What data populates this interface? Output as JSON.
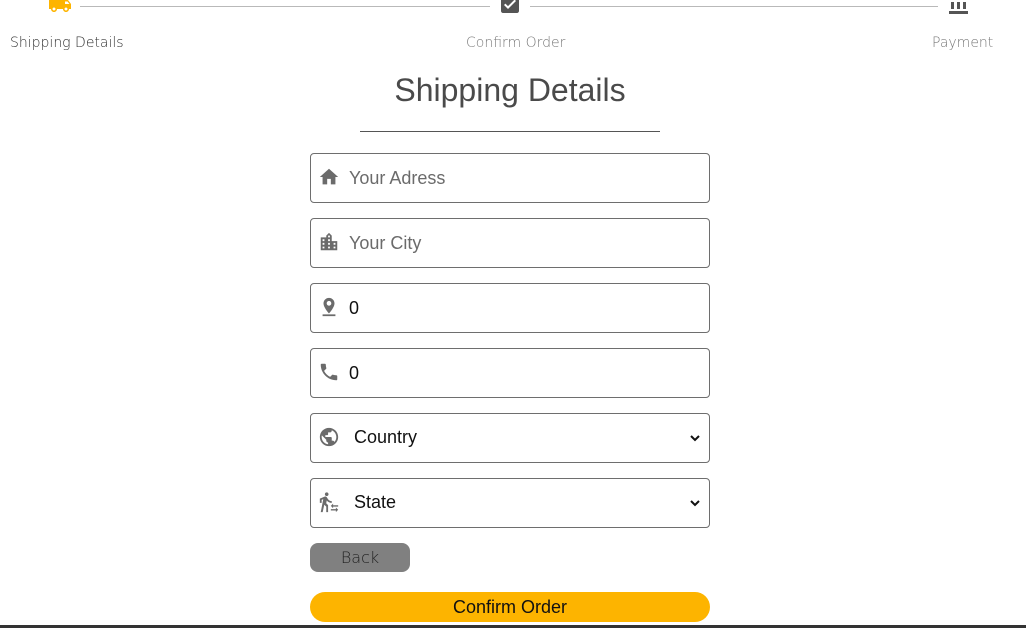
{
  "stepper": {
    "steps": [
      {
        "label": "Shipping Details",
        "icon": "truck-icon",
        "active": true
      },
      {
        "label": "Confirm Order",
        "icon": "checklist-icon",
        "active": false
      },
      {
        "label": "Payment",
        "icon": "bank-icon",
        "active": false
      }
    ]
  },
  "page": {
    "title": "Shipping Details"
  },
  "form": {
    "address": {
      "placeholder": "Your Adress",
      "value": "",
      "icon": "home-icon"
    },
    "city": {
      "placeholder": "Your City",
      "value": "",
      "icon": "city-icon"
    },
    "pincode": {
      "value": "0",
      "icon": "location-pin-icon"
    },
    "phone": {
      "value": "0",
      "icon": "phone-icon"
    },
    "country": {
      "selected": "Country",
      "icon": "globe-icon"
    },
    "state": {
      "selected": "State",
      "icon": "transfer-within-station-icon"
    }
  },
  "buttons": {
    "back_label": "Back",
    "confirm_label": "Confirm Order"
  },
  "colors": {
    "accent": "#fdb400",
    "back_button": "#808080",
    "icon": "#6b6b6b",
    "active_step_icon": "#fdb400"
  }
}
